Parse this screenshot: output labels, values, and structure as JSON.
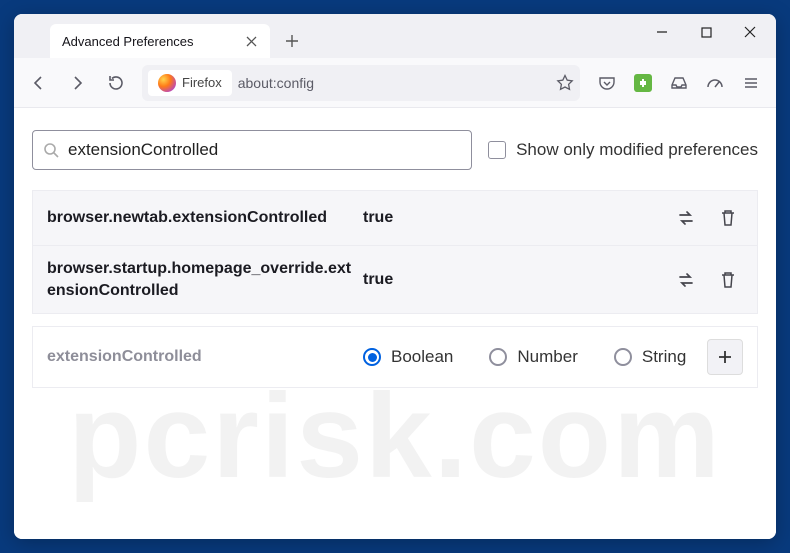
{
  "tab": {
    "title": "Advanced Preferences"
  },
  "nav": {
    "identity_label": "Firefox",
    "url": "about:config"
  },
  "search": {
    "value": "extensionControlled",
    "show_only_modified_label": "Show only modified preferences"
  },
  "rows": {
    "0": {
      "name": "browser.newtab.extensionControlled",
      "value": "true"
    },
    "1": {
      "name": "browser.startup.homepage_override.extensionControlled",
      "value": "true"
    }
  },
  "addrow": {
    "name": "extensionControlled",
    "types": {
      "boolean": "Boolean",
      "number": "Number",
      "string": "String"
    }
  },
  "watermark": "pcrisk.com"
}
